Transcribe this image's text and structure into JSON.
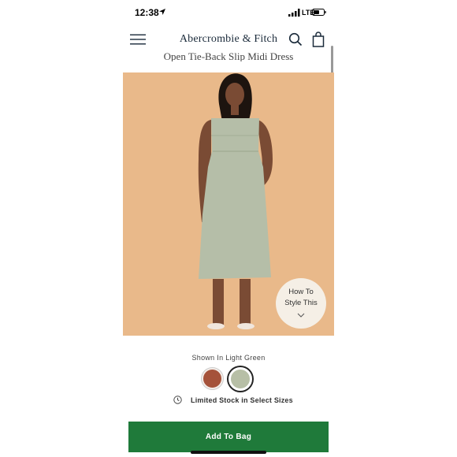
{
  "status_bar": {
    "time": "12:38",
    "network": "LTE"
  },
  "header": {
    "brand": "Abercrombie & Fitch",
    "menu_icon": "hamburger-icon",
    "search_icon": "search-icon",
    "bag_icon": "shopping-bag-icon"
  },
  "product": {
    "title": "Open Tie-Back Slip Midi Dress",
    "image_dots": 7,
    "active_dot": 2,
    "style_button": {
      "line1": "How To",
      "line2": "Style This"
    },
    "shown_in": "Shown In Light Green",
    "swatches": [
      {
        "color": "#a5523a",
        "selected": false
      },
      {
        "color": "#b7bfa6",
        "selected": true
      }
    ],
    "stock_message": "Limited Stock in Select Sizes"
  },
  "actions": {
    "add_to_bag": "Add To Bag"
  },
  "colors": {
    "accent_button": "#1f7a3a",
    "image_bg": "#e9b98a"
  }
}
